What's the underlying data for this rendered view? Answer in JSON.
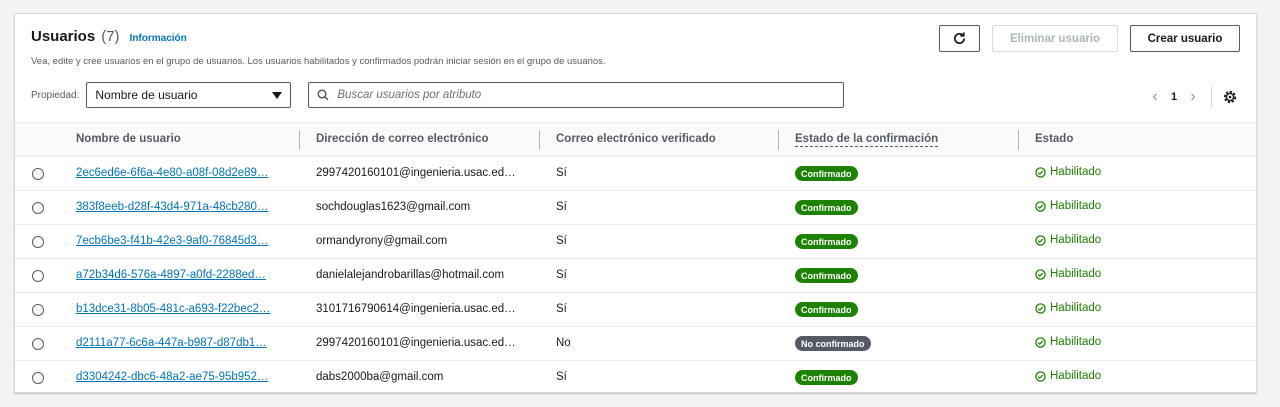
{
  "header": {
    "title": "Usuarios",
    "count": "(7)",
    "info": "Información",
    "description": "Vea, edite y cree usuarios en el grupo de usuarios. Los usuarios habilitados y confirmados podrán iniciar sesión en el grupo de usuarios."
  },
  "actions": {
    "refresh_icon": "refresh-icon",
    "delete_label": "Eliminar usuario",
    "create_label": "Crear usuario"
  },
  "filters": {
    "property_label": "Propiedad:",
    "property_value": "Nombre de usuario",
    "search_placeholder": "Buscar usuarios por atributo"
  },
  "pagination": {
    "page": "1"
  },
  "table": {
    "columns": [
      "Nombre de usuario",
      "Dirección de correo electrónico",
      "Correo electrónico verificado",
      "Estado de la confirmación",
      "Estado"
    ],
    "rows": [
      {
        "username": "2ec6ed6e-6f6a-4e80-a08f-08d2e89…",
        "email": "2997420160101@ingenieria.usac.ed…",
        "verified": "Sí",
        "confirmation": "Confirmado",
        "status": "Habilitado"
      },
      {
        "username": "383f8eeb-d28f-43d4-971a-48cb280…",
        "email": "sochdouglas1623@gmail.com",
        "verified": "Sí",
        "confirmation": "Confirmado",
        "status": "Habilitado"
      },
      {
        "username": "7ecb6be3-f41b-42e3-9af0-76845d3…",
        "email": "ormandyrony@gmail.com",
        "verified": "Sí",
        "confirmation": "Confirmado",
        "status": "Habilitado"
      },
      {
        "username": "a72b34d6-576a-4897-a0fd-2288ed…",
        "email": "danielalejandrobarillas@hotmail.com",
        "verified": "Sí",
        "confirmation": "Confirmado",
        "status": "Habilitado"
      },
      {
        "username": "b13dce31-8b05-481c-a693-f22bec2…",
        "email": "3101716790614@ingenieria.usac.ed…",
        "verified": "Sí",
        "confirmation": "Confirmado",
        "status": "Habilitado"
      },
      {
        "username": "d2111a77-6c6a-447a-b987-d87db1…",
        "email": "2997420160101@ingenieria.usac.ed…",
        "verified": "No",
        "confirmation": "No confirmado",
        "status": "Habilitado"
      },
      {
        "username": "d3304242-dbc6-48a2-ae75-95b952…",
        "email": "dabs2000ba@gmail.com",
        "verified": "Sí",
        "confirmation": "Confirmado",
        "status": "Habilitado"
      }
    ]
  },
  "colors": {
    "link": "#0073bb",
    "confirmed": "#1d8102",
    "unconfirmed": "#545b64",
    "enabled": "#1d8102"
  }
}
